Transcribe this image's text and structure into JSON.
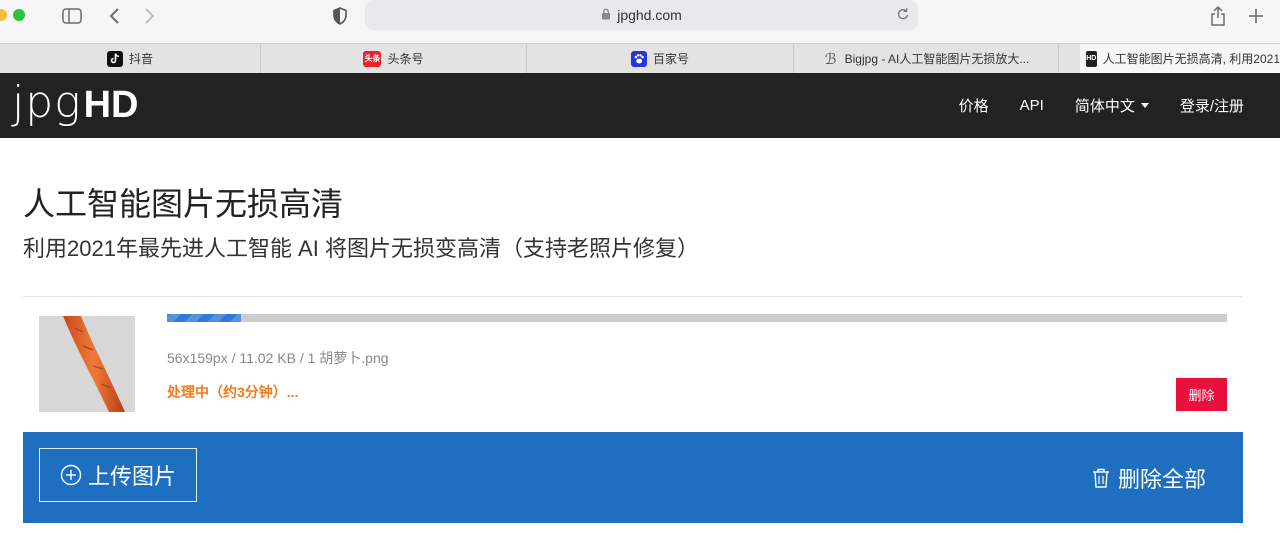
{
  "browser": {
    "url": "jpghd.com",
    "tabs": [
      {
        "label": "抖音",
        "icon": "tiktok-icon"
      },
      {
        "label": "头条号",
        "icon": "toutiao-icon",
        "icon_text": "头条"
      },
      {
        "label": "百家号",
        "icon": "baijiahao-paw-icon"
      },
      {
        "label": "Bigjpg - AI人工智能图片无损放大...",
        "icon": "bigjpg-b-icon"
      },
      {
        "label": "人工智能图片无损高清, 利用2021",
        "icon": "jpghd-icon",
        "icon_text": "HD",
        "active": true
      }
    ]
  },
  "site": {
    "logo_jpg": "jpg",
    "logo_hd": "HD",
    "nav": {
      "pricing": "价格",
      "api": "API",
      "language": "简体中文",
      "login": "登录/注册"
    }
  },
  "main": {
    "title": "人工智能图片无损高清",
    "subtitle": "利用2021年最先进人工智能 AI 将图片无损变高清（支持老照片修复）"
  },
  "upload_item": {
    "file_info": "56x159px / 11.02 KB / 1 胡萝卜.png",
    "status": "处理中（约3分钟）...",
    "progress_percent": 7,
    "delete_label": "删除"
  },
  "actions": {
    "upload_label": "上传图片",
    "delete_all_label": "删除全部"
  },
  "colors": {
    "header_bg": "#222222",
    "progress_blue": "#2f7bd3",
    "status_orange": "#f07a1c",
    "delete_red": "#e8113e",
    "upload_bar_blue": "#1f6fc1"
  }
}
